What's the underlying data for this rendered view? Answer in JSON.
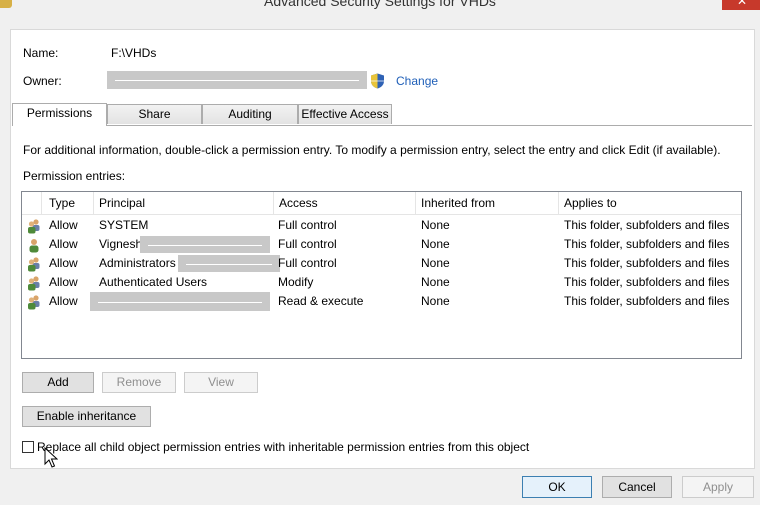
{
  "window": {
    "title": "Advanced Security Settings for VHDs"
  },
  "fields": {
    "name_label": "Name:",
    "name_value": "F:\\VHDs",
    "owner_label": "Owner:",
    "change_link": "Change"
  },
  "tabs": [
    {
      "label": "Permissions",
      "active": true
    },
    {
      "label": "Share"
    },
    {
      "label": "Auditing"
    },
    {
      "label": "Effective Access"
    }
  ],
  "info_text": "For additional information, double-click a permission entry. To modify a permission entry, select the entry and click Edit (if available).",
  "entries_label": "Permission entries:",
  "columns": [
    "Type",
    "Principal",
    "Access",
    "Inherited from",
    "Applies to"
  ],
  "rows": [
    {
      "type": "Allow",
      "principal": "SYSTEM",
      "access": "Full control",
      "inherited": "None",
      "applies": "This folder, subfolders and files",
      "icon": "users-group-icon"
    },
    {
      "type": "Allow",
      "principal": "Vignesh",
      "access": "Full control",
      "inherited": "None",
      "applies": "This folder, subfolders and files",
      "icon": "user-icon"
    },
    {
      "type": "Allow",
      "principal": "Administrators",
      "access": "Full control",
      "inherited": "None",
      "applies": "This folder, subfolders and files",
      "icon": "users-group-icon"
    },
    {
      "type": "Allow",
      "principal": "Authenticated Users",
      "access": "Modify",
      "inherited": "None",
      "applies": "This folder, subfolders and files",
      "icon": "users-group-icon"
    },
    {
      "type": "Allow",
      "principal": "",
      "access": "Read & execute",
      "inherited": "None",
      "applies": "This folder, subfolders and files",
      "icon": "users-group-icon"
    }
  ],
  "buttons": {
    "add": "Add",
    "remove": "Remove",
    "view": "View",
    "enable_inheritance": "Enable inheritance",
    "ok": "OK",
    "cancel": "Cancel",
    "apply": "Apply"
  },
  "checkbox": {
    "label": "Replace all child object permission entries with inheritable permission entries from this object",
    "checked": false
  }
}
